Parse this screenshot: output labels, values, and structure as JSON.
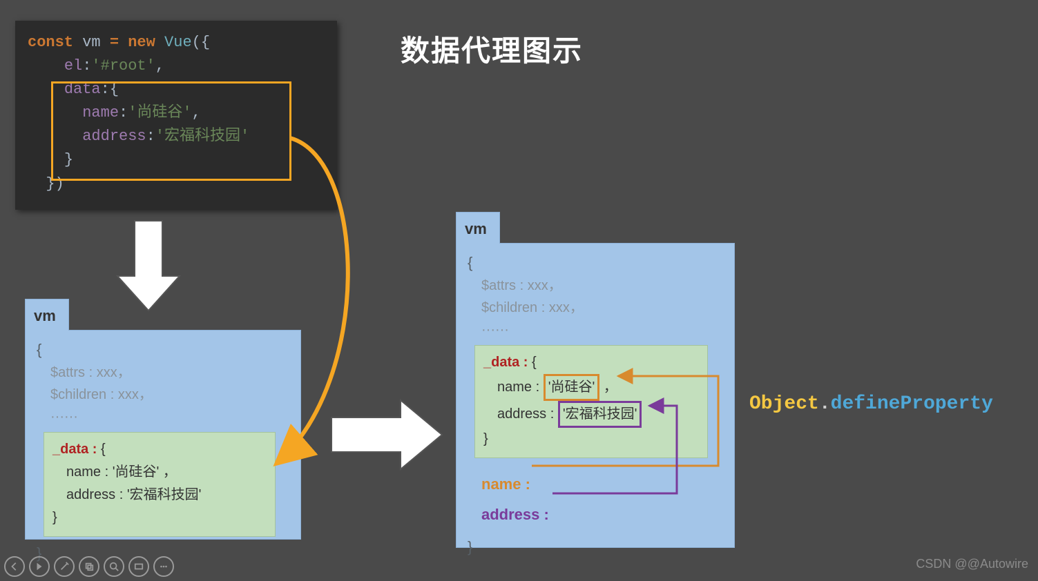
{
  "title": "数据代理图示",
  "code": {
    "const": "const",
    "vm": "vm",
    "eq_new": "= new",
    "Vue": "Vue",
    "open": "({",
    "el_key": "el",
    "el_val": "'#root'",
    "data_key": "data",
    "name_key": "name",
    "name_val": "'尚硅谷'",
    "addr_key": "address",
    "addr_val": "'宏福科技园'",
    "close": "})"
  },
  "vm_common": {
    "tab": "vm",
    "open": "{",
    "attrs": "$attrs : xxx，",
    "children": "$children : xxx，",
    "dots": "······",
    "close": "}"
  },
  "data_box": {
    "label": "_data :",
    "open": "{",
    "name_key": "name",
    "name_val": "'尚硅谷'",
    "addr_key": "address",
    "addr_val": "'宏福科技园'",
    "comma": "，",
    "close": "}"
  },
  "proxy": {
    "name": "name :",
    "address": "address :"
  },
  "define": {
    "object": "Object",
    "dot": ".",
    "method": "defineProperty"
  },
  "watermark": "CSDN @@Autowire"
}
